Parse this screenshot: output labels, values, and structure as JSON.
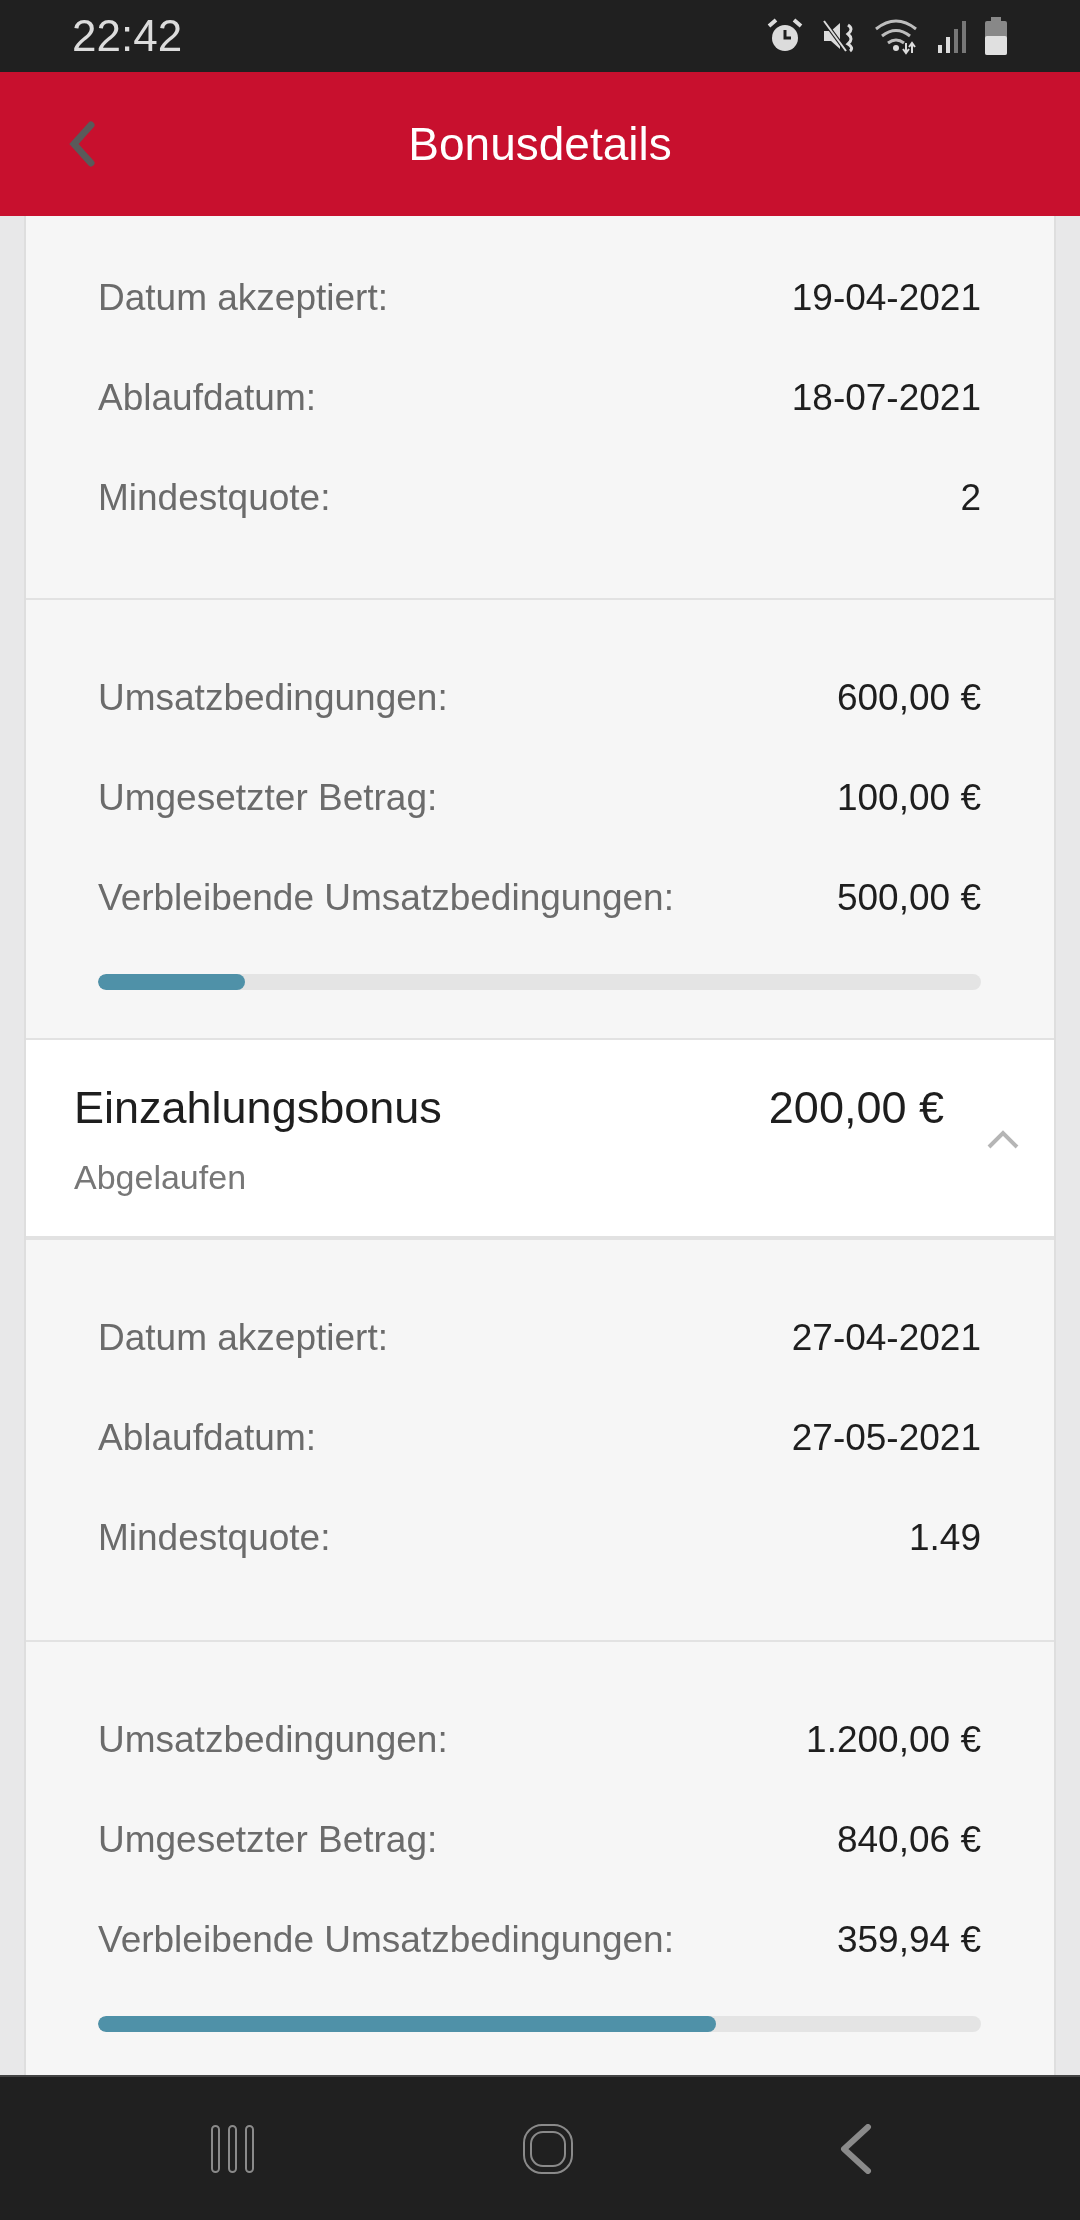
{
  "status_bar": {
    "time": "22:42"
  },
  "header": {
    "title": "Bonusdetails"
  },
  "blocks": [
    {
      "kind": "details",
      "rows": [
        {
          "label": "Datum akzeptiert:",
          "value": "19-04-2021"
        },
        {
          "label": "Ablaufdatum:",
          "value": "18-07-2021"
        },
        {
          "label": "Mindestquote:",
          "value": "2"
        }
      ]
    },
    {
      "kind": "wagering",
      "rows": [
        {
          "label": "Umsatzbedingungen:",
          "value": "600,00 €"
        },
        {
          "label": "Umgesetzter Betrag:",
          "value": "100,00 €"
        },
        {
          "label": "Verbleibende Umsatzbedingungen:",
          "value": "500,00 €"
        }
      ],
      "level": 0.166
    },
    {
      "kind": "bonus_header",
      "title": "Einzahlungsbonus",
      "amount": "200,00 €",
      "status": "Abgelaufen",
      "expanded": true
    },
    {
      "kind": "details",
      "rows": [
        {
          "label": "Datum akzeptiert:",
          "value": "27-04-2021"
        },
        {
          "label": "Ablaufdatum:",
          "value": "27-05-2021"
        },
        {
          "label": "Mindestquote:",
          "value": "1.49"
        }
      ]
    },
    {
      "kind": "wagering",
      "rows": [
        {
          "label": "Umsatzbedingungen:",
          "value": "1.200,00 €"
        },
        {
          "label": "Umgesetzter Betrag:",
          "value": "840,06 €"
        },
        {
          "label": "Verbleibende Umsatzbedingungen:",
          "value": "359,94 €"
        }
      ],
      "level": 0.7
    }
  ]
}
